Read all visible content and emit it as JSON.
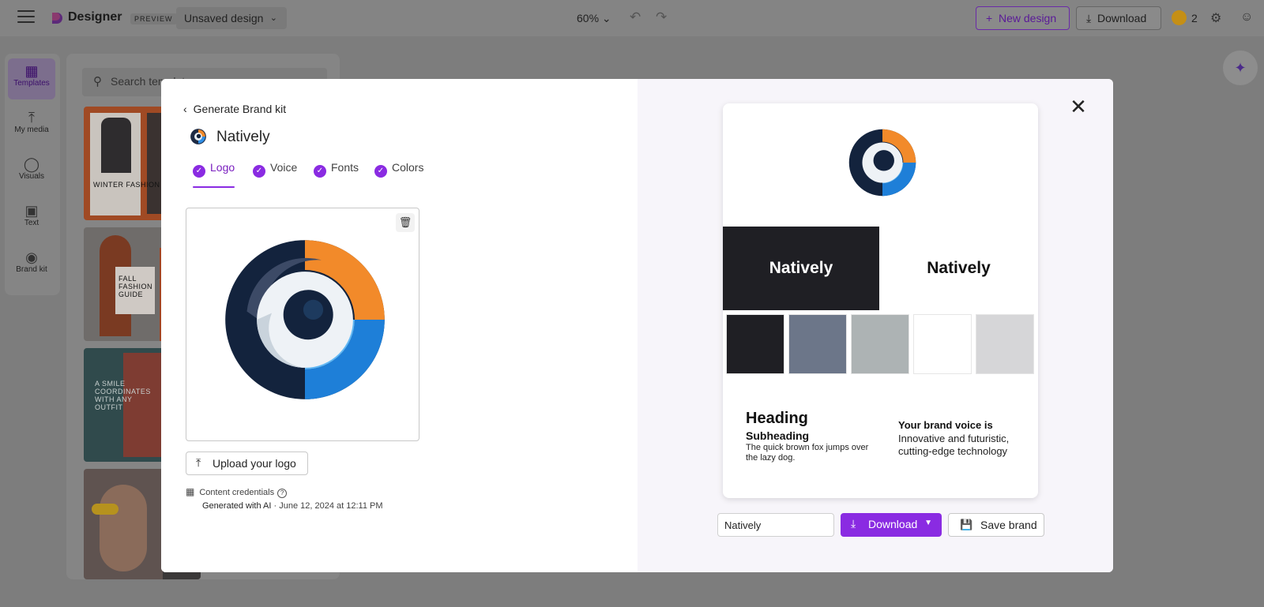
{
  "topbar": {
    "app_name": "Designer",
    "preview_badge": "PREVIEW",
    "doc_name": "Unsaved design",
    "zoom": "60%",
    "new_design_label": "New design",
    "download_label": "Download",
    "coins": "2"
  },
  "rail": {
    "items": [
      {
        "label": "Templates",
        "icon": "templates-icon"
      },
      {
        "label": "My media",
        "icon": "upload-icon"
      },
      {
        "label": "Visuals",
        "icon": "visuals-icon"
      },
      {
        "label": "Text",
        "icon": "text-icon"
      },
      {
        "label": "Brand kit",
        "icon": "palette-icon"
      }
    ]
  },
  "templates_panel": {
    "search_placeholder": "Search templates",
    "thumbnails": [
      {
        "caption": "WINTER FASHION LOOKS"
      },
      {
        "caption": "FALL FASHION GUIDE"
      },
      {
        "caption": "A SMILE COORDINATES WITH ANY OUTFIT"
      },
      {
        "caption": ""
      }
    ]
  },
  "modal": {
    "back_label": "Generate Brand kit",
    "brand_name": "Natively",
    "tabs": [
      {
        "label": "Logo",
        "active": true
      },
      {
        "label": "Voice",
        "active": false
      },
      {
        "label": "Fonts",
        "active": false
      },
      {
        "label": "Colors",
        "active": false
      }
    ],
    "upload_label": "Upload your logo",
    "credentials_label": "Content credentials",
    "generated_with": "Generated with AI",
    "generated_date": " · June 12, 2024 at 12:11 PM",
    "preview": {
      "dark_name": "Natively",
      "light_name": "Natively",
      "swatches": [
        "#1f1f24",
        "#6c7689",
        "#adb3b4",
        "#ffffff",
        "#d6d6d8"
      ],
      "heading": "Heading",
      "subheading": "Subheading",
      "body": "The quick brown fox jumps over the lazy dog.",
      "voice_title": "Your brand voice is",
      "voice_text": "Innovative and futuristic, cutting-edge technology"
    },
    "name_input_value": "Natively",
    "download_label": "Download",
    "save_label": "Save brand"
  },
  "colors": {
    "accent": "#8a2be2",
    "overlay": "#7d7d7d"
  }
}
